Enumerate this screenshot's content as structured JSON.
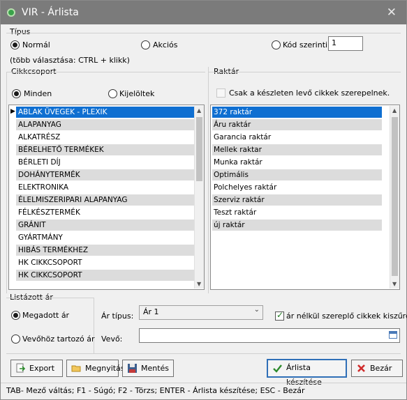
{
  "window": {
    "title": "VIR - Árlista",
    "close_icon": "close-icon"
  },
  "tipus": {
    "label": "Típus",
    "options": [
      "Normál",
      "Akciós",
      "Kód szerinti"
    ],
    "selected": "Normál",
    "code_value": "1"
  },
  "hint": "(több választása: CTRL + klikk)",
  "cikkcsoport": {
    "label": "Cikkcsoport",
    "radio_all": "Minden",
    "radio_selected": "Kijelöltek",
    "selected_radio": "Minden",
    "items": [
      "ABLAK ÜVEGEK - PLEXIK",
      "ALAPANYAG",
      "ALKATRÉSZ",
      "BÉRELHETŐ TERMÉKEK",
      "BÉRLETI DÍJ",
      "DOHÁNYTERMÉK",
      "ELEKTRONIKA",
      "ÉLELMISZERIPARI ALAPANYAG",
      "FÉLKÉSZTERMÉK",
      "GRÁNIT",
      "GYÁRTMÁNY",
      "HIBÁS TERMÉKHEZ",
      "HK CIKKCSOPORT",
      "HK CIKKCSOPORT"
    ],
    "selected_index": 0
  },
  "raktar": {
    "label": "Raktár",
    "checkbox_label": "Csak a készleten levő cikkek szerepelnek.",
    "checkbox_checked": false,
    "items": [
      "372 raktár",
      "Áru raktár",
      "Garancia raktár",
      "Mellek raktar",
      "Munka raktár",
      "Optimális",
      "Polchelyes raktár",
      "Szerviz raktár",
      "Teszt raktár",
      "új raktár"
    ],
    "selected_index": 0
  },
  "listazott_ar": {
    "label": "Listázott ár",
    "option_given": "Megadott ár",
    "option_customer": "Vevőhöz tartozó ár",
    "selected": "Megadott ár"
  },
  "ar_tipus": {
    "label": "Ár típus:",
    "value": "Ár 1"
  },
  "filter_checkbox": {
    "label": "ár nélkül szereplő cikkek kiszűrése",
    "checked": true
  },
  "vevo": {
    "label": "Vevő:",
    "value": ""
  },
  "buttons": {
    "export": "Export",
    "open": "Megnyitás",
    "save": "Mentés",
    "create": "Árlista készítése",
    "close": "Bezár"
  },
  "status": "TAB- Mező váltás; F1 - Súgó; F2 - Törzs; ENTER - Árlista készítése; ESC - Bezár",
  "colors": {
    "selection": "#0f6fd1",
    "titlebar": "#7b7b7b",
    "alt_row": "#dcdcdc"
  }
}
